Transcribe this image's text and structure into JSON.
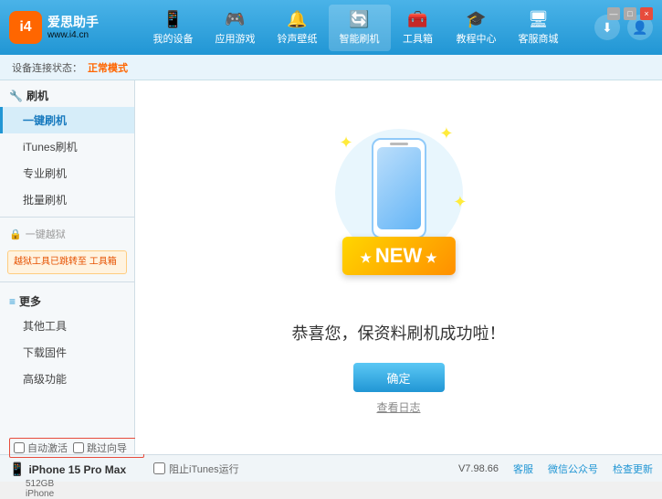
{
  "header": {
    "logo_name": "爱思助手",
    "logo_sub": "www.i4.cn",
    "logo_letter": "i4",
    "nav_tabs": [
      {
        "id": "my-device",
        "label": "我的设备",
        "icon": "📱"
      },
      {
        "id": "app-games",
        "label": "应用游戏",
        "icon": "👤"
      },
      {
        "id": "ringtone",
        "label": "铃声壁纸",
        "icon": "🔔"
      },
      {
        "id": "smart-flash",
        "label": "智能刷机",
        "icon": "🔄"
      },
      {
        "id": "toolbox",
        "label": "工具箱",
        "icon": "🧰"
      },
      {
        "id": "tutorials",
        "label": "教程中心",
        "icon": "🎓"
      },
      {
        "id": "service",
        "label": "客服商城",
        "icon": "🖥"
      }
    ],
    "download_icon": "⬇",
    "user_icon": "👤"
  },
  "breadcrumb": {
    "prefix": "设备连接状态：",
    "status": "正常模式"
  },
  "sidebar": {
    "flash_section": {
      "icon": "🔧",
      "title": "刷机"
    },
    "items": [
      {
        "id": "one-key-flash",
        "label": "一键刷机",
        "active": true
      },
      {
        "id": "itunes-flash",
        "label": "iTunes刷机",
        "active": false
      },
      {
        "id": "pro-flash",
        "label": "专业刷机",
        "active": false
      },
      {
        "id": "batch-flash",
        "label": "批量刷机",
        "active": false
      }
    ],
    "disabled_section": {
      "icon": "🔒",
      "label": "一键越狱"
    },
    "note_text": "越狱工具已跳转至\n工具箱",
    "more_section": {
      "icon": "≡",
      "title": "更多"
    },
    "more_items": [
      {
        "id": "other-tools",
        "label": "其他工具"
      },
      {
        "id": "download-firmware",
        "label": "下载固件"
      },
      {
        "id": "advanced",
        "label": "高级功能"
      }
    ]
  },
  "content": {
    "new_label": "NEW",
    "success_title": "恭喜您，保资料刷机成功啦！",
    "confirm_button": "确定",
    "log_link": "查看日志"
  },
  "bottom": {
    "auto_activate_label": "自动激活",
    "time_guide_label": "跳过向导",
    "device_name": "iPhone 15 Pro Max",
    "device_storage": "512GB",
    "device_type": "iPhone",
    "itunes_label": "阻止iTunes运行",
    "version": "V7.98.66",
    "links": [
      "客服",
      "微信公众号",
      "检查更新"
    ]
  },
  "win_controls": {
    "min": "—",
    "max": "□",
    "close": "×"
  }
}
